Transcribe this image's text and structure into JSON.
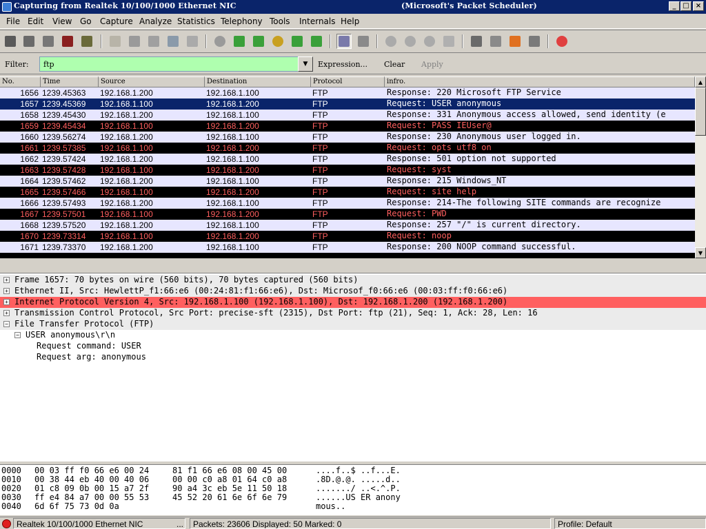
{
  "window": {
    "title": "Capturing from Realtek 10/100/1000 Ethernet NIC",
    "title_extra": "(Microsoft's Packet Scheduler)",
    "min_label": "_",
    "max_label": "□",
    "close_label": "×"
  },
  "menu": [
    "File",
    "Edit",
    "View",
    "Go",
    "Capture",
    "Analyze",
    "Statistics",
    "Telephony",
    "Tools",
    "Internals",
    "Help"
  ],
  "filter": {
    "label": "Filter:",
    "value": "ftp",
    "expression_label": "Expression...",
    "clear_label": "Clear",
    "apply_label": "Apply"
  },
  "packet_list": {
    "columns": [
      "No.",
      "Time",
      "Source",
      "Destination",
      "Protocol",
      "infro."
    ],
    "rows": [
      {
        "no": "1656",
        "time": "1239.45363",
        "src": "192.168.1.200",
        "dst": "192.168.1.100",
        "proto": "FTP",
        "info": "Response: 220 Microsoft FTP Service",
        "style": "normal"
      },
      {
        "no": "1657",
        "time": "1239.45369",
        "src": "192.168.1.100",
        "dst": "192.168.1.200",
        "proto": "FTP",
        "info": "Request: USER anonymous",
        "style": "sel"
      },
      {
        "no": "1658",
        "time": "1239.45430",
        "src": "192.168.1.200",
        "dst": "192.168.1.100",
        "proto": "FTP",
        "info": "Response: 331 Anonymous access allowed, send identity (e",
        "style": "normal"
      },
      {
        "no": "1659",
        "time": "1239.45434",
        "src": "192.168.1.100",
        "dst": "192.168.1.200",
        "proto": "FTP",
        "info": "Request: PASS IEUser@",
        "style": "dark"
      },
      {
        "no": "1660",
        "time": "1239.56274",
        "src": "192.168.1.200",
        "dst": "192.168.1.100",
        "proto": "FTP",
        "info": "Response: 230 Anonymous user logged in.",
        "style": "normal"
      },
      {
        "no": "1661",
        "time": "1239.57385",
        "src": "192.168.1.100",
        "dst": "192.168.1.200",
        "proto": "FTP",
        "info": "Request: opts utf8 on",
        "style": "dark"
      },
      {
        "no": "1662",
        "time": "1239.57424",
        "src": "192.168.1.200",
        "dst": "192.168.1.100",
        "proto": "FTP",
        "info": "Response: 501 option not supported",
        "style": "normal"
      },
      {
        "no": "1663",
        "time": "1239.57428",
        "src": "192.168.1.100",
        "dst": "192.168.1.200",
        "proto": "FTP",
        "info": "Request: syst",
        "style": "dark"
      },
      {
        "no": "1664",
        "time": "1239.57462",
        "src": "192.168.1.200",
        "dst": "192.168.1.100",
        "proto": "FTP",
        "info": "Response: 215 Windows_NT",
        "style": "normal"
      },
      {
        "no": "1665",
        "time": "1239.57466",
        "src": "192.168.1.100",
        "dst": "192.168.1.200",
        "proto": "FTP",
        "info": "Request: site help",
        "style": "dark"
      },
      {
        "no": "1666",
        "time": "1239.57493",
        "src": "192.168.1.200",
        "dst": "192.168.1.100",
        "proto": "FTP",
        "info": "Response: 214-The following SITE  commands are recognize",
        "style": "normal"
      },
      {
        "no": "1667",
        "time": "1239.57501",
        "src": "192.168.1.100",
        "dst": "192.168.1.200",
        "proto": "FTP",
        "info": "Request: PWD",
        "style": "dark"
      },
      {
        "no": "1668",
        "time": "1239.57520",
        "src": "192.168.1.200",
        "dst": "192.168.1.100",
        "proto": "FTP",
        "info": "Response: 257 \"/\" is current directory.",
        "style": "normal"
      },
      {
        "no": "1670",
        "time": "1239.73314",
        "src": "192.168.1.100",
        "dst": "192.168.1.200",
        "proto": "FTP",
        "info": "Request: noop",
        "style": "dark"
      },
      {
        "no": "1671",
        "time": "1239.73370",
        "src": "192.168.1.200",
        "dst": "192.168.1.100",
        "proto": "FTP",
        "info": "Response: 200 NOOP command successful.",
        "style": "normal"
      }
    ]
  },
  "details": [
    {
      "text": "Frame 1657: 70 bytes on wire (560 bits), 70 bytes captured (560 bits)",
      "expander": "+",
      "style": "gray"
    },
    {
      "text": "Ethernet II, Src: HewlettP_f1:66:e6 (00:24:81:f1:66:e6), Dst: Microsof_f0:66:e6 (00:03:ff:f0:66:e6)",
      "expander": "+",
      "style": "gray"
    },
    {
      "text": "Internet Protocol Version 4, Src: 192.168.1.100 (192.168.1.100), Dst: 192.168.1.200 (192.168.1.200)",
      "expander": "+",
      "style": "red"
    },
    {
      "text": "Transmission Control Protocol, Src Port: precise-sft (2315), Dst Port: ftp (21), Seq: 1, Ack: 28, Len: 16",
      "expander": "+",
      "style": "gray"
    },
    {
      "text": "File Transfer Protocol (FTP)",
      "expander": "−",
      "style": "gray"
    },
    {
      "text": "USER anonymous\\r\\n",
      "expander": "−",
      "style": "plain"
    },
    {
      "text": "Request command: USER",
      "expander": "",
      "style": "plain"
    },
    {
      "text": "Request arg: anonymous",
      "expander": "",
      "style": "plain"
    }
  ],
  "bytes": [
    {
      "offset": "0000",
      "hex1": "00 03 ff f0 66 e6 00 24",
      "hex2": "81 f1 66 e6 08 00 45 00",
      "ascii": "....f..$ ..f...E."
    },
    {
      "offset": "0010",
      "hex1": "00 38 44 eb 40 00 40 06",
      "hex2": "00 00 c0 a8 01 64 c0 a8",
      "ascii": ".8D.@.@. .....d.."
    },
    {
      "offset": "0020",
      "hex1": "01 c8 09 0b 00 15 a7 2f",
      "hex2": "90 a4 3c eb 5e 11 50 18",
      "ascii": "......./ ..<.^.P."
    },
    {
      "offset": "0030",
      "hex1": "ff e4 84 a7 00 00 55 53",
      "hex2": "45 52 20 61 6e 6f 6e 79",
      "ascii": "......US ER anony"
    },
    {
      "offset": "0040",
      "hex1": "6d 6f 75 73 0d 0a",
      "hex2": "",
      "ascii": "mous.."
    }
  ],
  "status": {
    "interface": "Realtek 10/100/1000 Ethernet NIC",
    "interface_more": "...",
    "packets": "Packets: 23606 Displayed: 50 Marked: 0",
    "profile": "Profile: Default"
  },
  "colors": {
    "filter_valid": "#afffaf",
    "selected_row": "#0a246a",
    "dark_row": "#000000",
    "dark_row_text": "#ff5f5f",
    "ftp_row": "#e7e6ff",
    "ip_highlight": "#ff5f5f"
  },
  "toolbar_icons": [
    "interfaces-icon",
    "options-icon",
    "start-capture-icon",
    "stop-capture-icon",
    "restart-capture-icon",
    "open-file-icon",
    "save-file-icon",
    "close-file-icon",
    "reload-icon",
    "print-icon",
    "find-icon",
    "go-back-icon",
    "go-forward-icon",
    "go-to-packet-icon",
    "go-first-icon",
    "go-last-icon",
    "colorize-icon",
    "auto-scroll-icon",
    "zoom-in-icon",
    "zoom-out-icon",
    "zoom-normal-icon",
    "resize-columns-icon",
    "capture-filters-icon",
    "display-filters-icon",
    "coloring-rules-icon",
    "preferences-icon",
    "help-icon"
  ]
}
